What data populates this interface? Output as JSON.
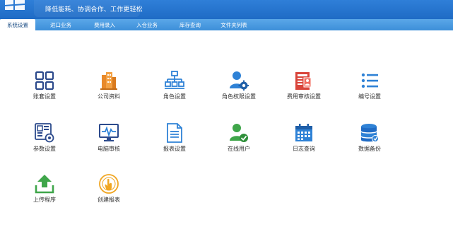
{
  "header": {
    "slogan": "降低能耗、协调合作、工作更轻松"
  },
  "tabs": [
    {
      "label": "系统设置",
      "active": true
    },
    {
      "label": "进口业务",
      "active": false
    },
    {
      "label": "费用录入",
      "active": false
    },
    {
      "label": "入仓业务",
      "active": false
    },
    {
      "label": "库存查询",
      "active": false
    },
    {
      "label": "文件夹列表",
      "active": false
    }
  ],
  "tiles": [
    {
      "label": "账套设置",
      "icon": "grid-squares-icon"
    },
    {
      "label": "公司资料",
      "icon": "company-building-icon"
    },
    {
      "label": "角色设置",
      "icon": "org-chart-icon"
    },
    {
      "label": "角色权限设置",
      "icon": "user-gear-icon"
    },
    {
      "label": "费用审核设置",
      "icon": "fee-audit-icon"
    },
    {
      "label": "编号设置",
      "icon": "numbered-list-icon"
    },
    {
      "label": "参数设置",
      "icon": "parameter-gear-icon"
    },
    {
      "label": "电脑审核",
      "icon": "monitor-pulse-icon"
    },
    {
      "label": "报表设置",
      "icon": "document-icon"
    },
    {
      "label": "在线用户",
      "icon": "user-check-icon"
    },
    {
      "label": "日志查询",
      "icon": "calendar-icon"
    },
    {
      "label": "数据备份",
      "icon": "database-icon"
    },
    {
      "label": "上传程序",
      "icon": "upload-icon"
    },
    {
      "label": "创建报表",
      "icon": "touch-hand-icon"
    }
  ],
  "colors": {
    "header_blue": "#1f6bc5",
    "tab_blue": "#4a9ae0",
    "icon_navy": "#2c4a8c",
    "icon_orange": "#e8892a",
    "icon_blue": "#2f82d6",
    "icon_red": "#d9453b",
    "icon_green": "#3fa64a",
    "icon_gold": "#f0a623"
  }
}
